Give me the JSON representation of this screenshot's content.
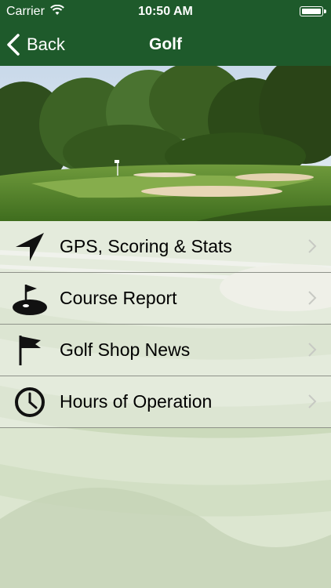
{
  "status_bar": {
    "carrier": "Carrier",
    "time": "10:50 AM"
  },
  "nav": {
    "back_label": "Back",
    "title": "Golf"
  },
  "menu": {
    "items": [
      {
        "label": "GPS, Scoring & Stats",
        "icon": "location-arrow-icon"
      },
      {
        "label": "Course Report",
        "icon": "golf-hole-flag-icon"
      },
      {
        "label": "Golf Shop News",
        "icon": "flag-icon"
      },
      {
        "label": "Hours of Operation",
        "icon": "clock-icon"
      }
    ]
  },
  "colors": {
    "header_green": "#1e5a2b",
    "separator": "#8e9289"
  }
}
